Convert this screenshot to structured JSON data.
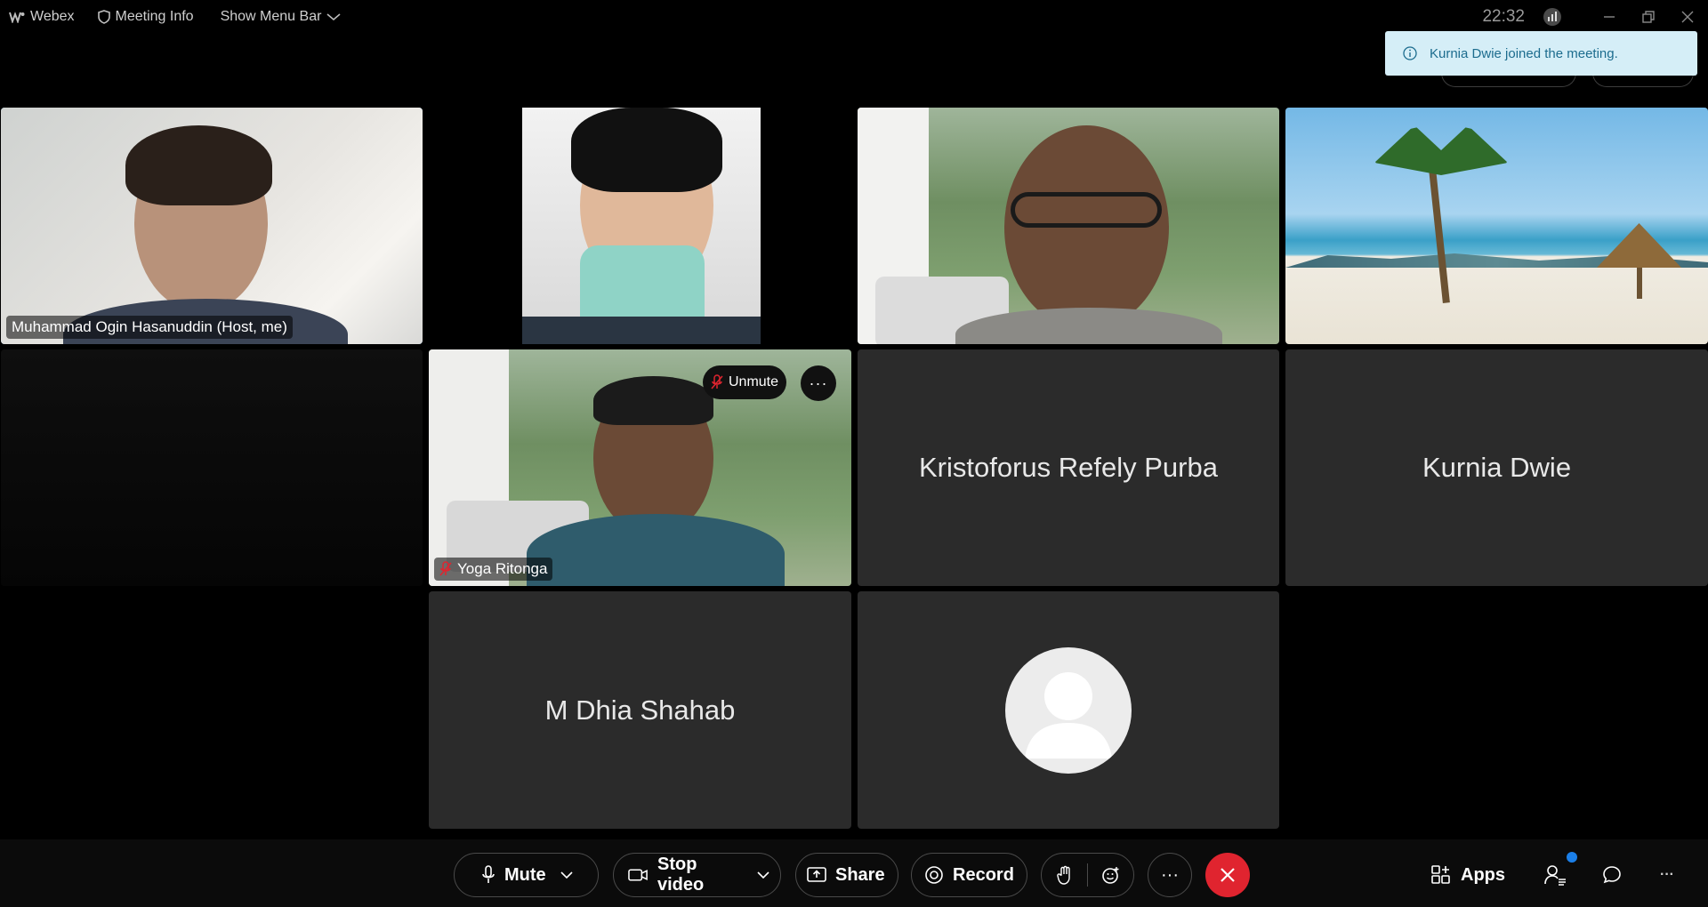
{
  "titlebar": {
    "app_name": "Webex",
    "meeting_info": "Meeting Info",
    "show_menu_bar": "Show Menu Bar",
    "time": "22:32"
  },
  "notification": {
    "text": "Kurnia Dwie joined the meeting."
  },
  "participants": {
    "host": {
      "name": "Muhammad Ogin Hasanuddin (Host, me)"
    },
    "yoga": {
      "name": "Yoga Ritonga",
      "unmute_label": "Unmute",
      "more_label": "···"
    },
    "kristoforus": {
      "name": "Kristoforus Refely Purba"
    },
    "kurnia": {
      "name": "Kurnia Dwie"
    },
    "dhia": {
      "name": "M Dhia Shahab"
    }
  },
  "controls": {
    "mute": "Mute",
    "stop_video": "Stop video",
    "share": "Share",
    "record": "Record",
    "more": "···",
    "apps": "Apps",
    "overflow": "···"
  },
  "colors": {
    "accent_border": "#5aa8e8",
    "leave_red": "#e0242f",
    "toast_bg": "#d5eef7",
    "badge_blue": "#1b7fe8"
  }
}
